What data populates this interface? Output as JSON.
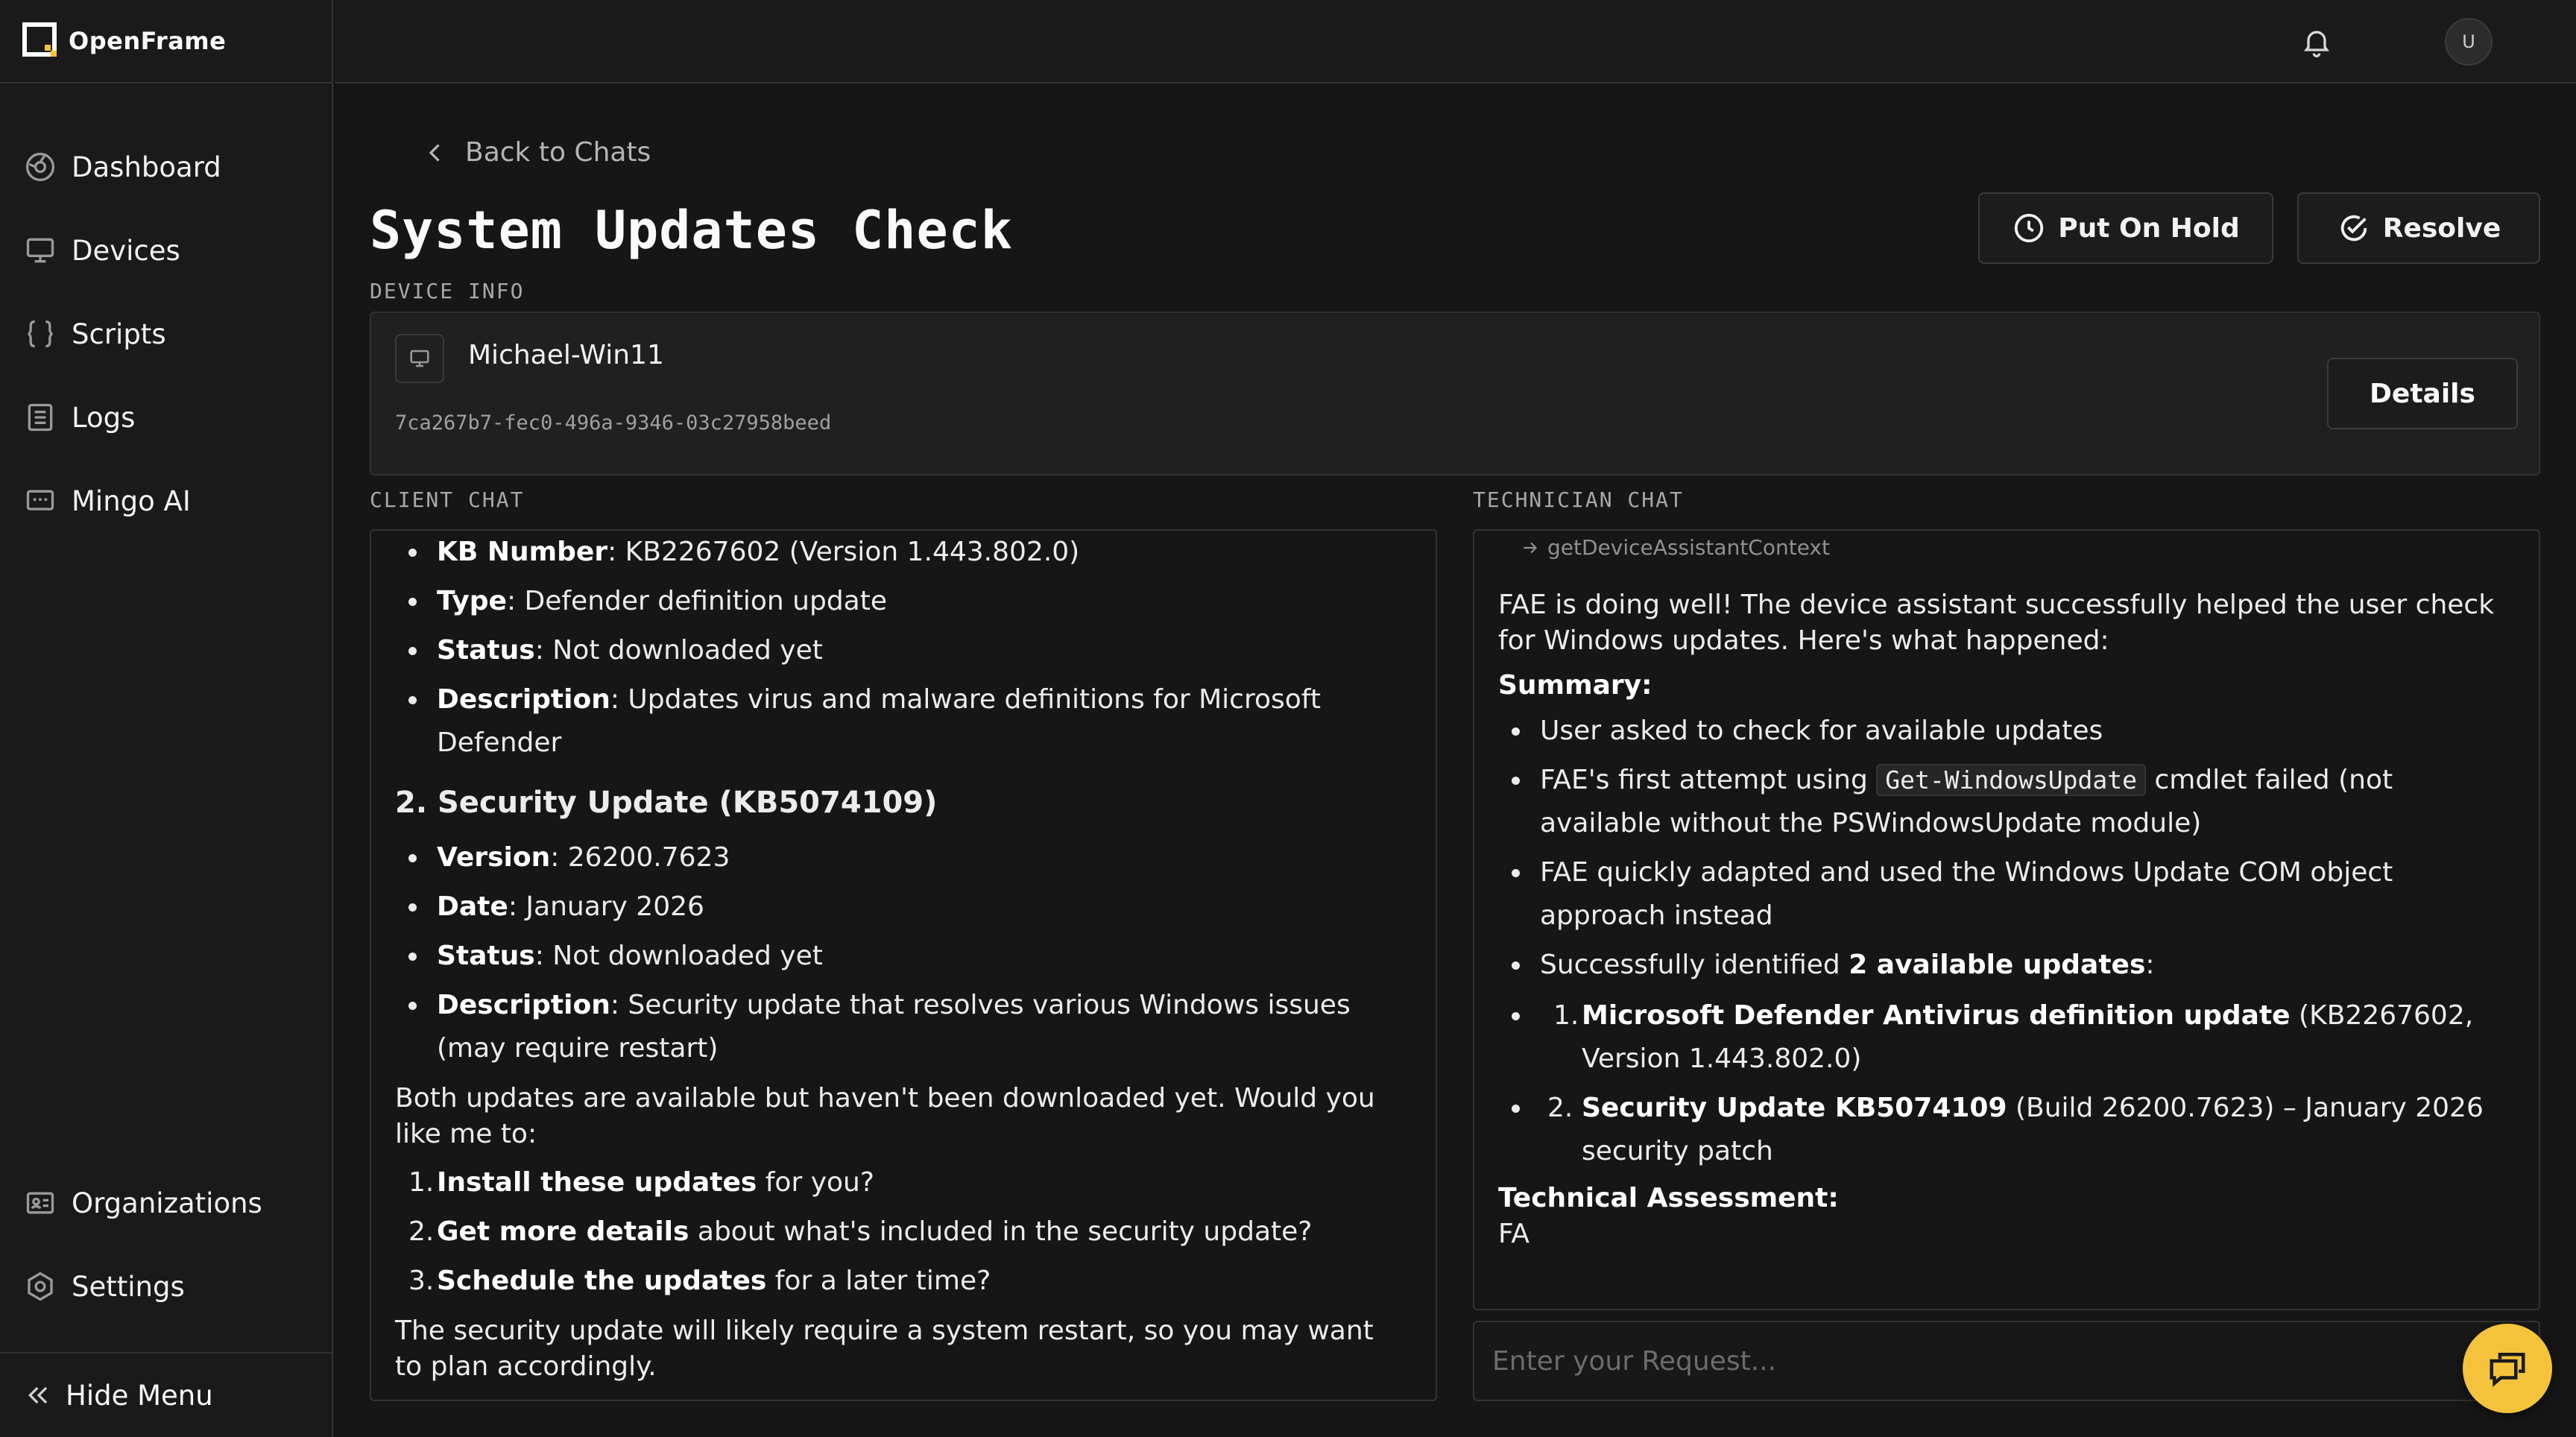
{
  "app": {
    "name": "OpenFrame",
    "accent": "#f5c33b"
  },
  "sidebar": {
    "items": [
      {
        "label": "Dashboard",
        "icon": "dashboard-icon"
      },
      {
        "label": "Devices",
        "icon": "monitor-icon"
      },
      {
        "label": "Scripts",
        "icon": "braces-icon"
      },
      {
        "label": "Logs",
        "icon": "log-list-icon"
      },
      {
        "label": "Mingo AI",
        "icon": "ai-chat-icon"
      }
    ],
    "bottom": [
      {
        "label": "Organizations",
        "icon": "id-card-icon"
      },
      {
        "label": "Settings",
        "icon": "gear-icon"
      }
    ],
    "hide_menu": "Hide Menu"
  },
  "topbar": {
    "avatar_initial": "U"
  },
  "page": {
    "back_label": "Back to Chats",
    "title": "System Updates Check",
    "put_on_hold": "Put On Hold",
    "resolve": "Resolve"
  },
  "device": {
    "section_label": "DEVICE INFO",
    "name": "Michael-Win11",
    "id": "7ca267b7-fec0-496a-9346-03c27958beed",
    "details_label": "Details"
  },
  "client_chat": {
    "label": "CLIENT CHAT",
    "update1": {
      "kb_key": "KB Number",
      "kb_val": ": KB2267602 (Version 1.443.802.0)",
      "type_key": "Type",
      "type_val": ": Defender definition update",
      "status_key": "Status",
      "status_val": ": Not downloaded yet",
      "desc_key": "Description",
      "desc_val": ": Updates virus and malware definitions for Microsoft Defender"
    },
    "heading2": "2. Security Update (KB5074109)",
    "update2": {
      "version_key": "Version",
      "version_val": ": 26200.7623",
      "date_key": "Date",
      "date_val": ": January 2026",
      "status_key": "Status",
      "status_val": ": Not downloaded yet",
      "desc_key": "Description",
      "desc_val": ": Security update that resolves various Windows issues (may require restart)"
    },
    "question": "Both updates are available but haven't been downloaded yet. Would you like me to:",
    "options": [
      {
        "num": "1.",
        "bold": "Install these updates",
        "rest": " for you?"
      },
      {
        "num": "2.",
        "bold": "Get more details",
        "rest": " about what's included in the security update?"
      },
      {
        "num": "3.",
        "bold": "Schedule the updates",
        "rest": " for a later time?"
      }
    ],
    "closing": "The security update will likely require a system restart, so you may want to plan accordingly."
  },
  "tech_chat": {
    "label": "TECHNICIAN CHAT",
    "tool_call": "getDeviceAssistantContext",
    "intro": "FAE is doing well! The device assistant successfully helped the user check for Windows updates. Here's what happened:",
    "summary_label": "Summary:",
    "b1": "User asked to check for available updates",
    "b2_pre": "FAE's first attempt using ",
    "b2_code": "Get-WindowsUpdate",
    "b2_post": " cmdlet failed (not available without the PSWindowsUpdate module)",
    "b3": "FAE quickly adapted and used the Windows Update COM object approach instead",
    "b4_pre": "Successfully identified ",
    "b4_bold": "2 available updates",
    "b4_post": ":",
    "sub1_num": "1.",
    "sub1_bold": "Microsoft Defender Antivirus definition update",
    "sub1_rest": " (KB2267602, Version 1.443.802.0)",
    "sub2_num": "2.",
    "sub2_bold": "Security Update KB5074109",
    "sub2_rest": " (Build 26200.7623) – January 2026 security patch",
    "assessment_label": "Technical Assessment:",
    "assessment_text": "FA"
  },
  "input": {
    "placeholder": "Enter your Request..."
  }
}
